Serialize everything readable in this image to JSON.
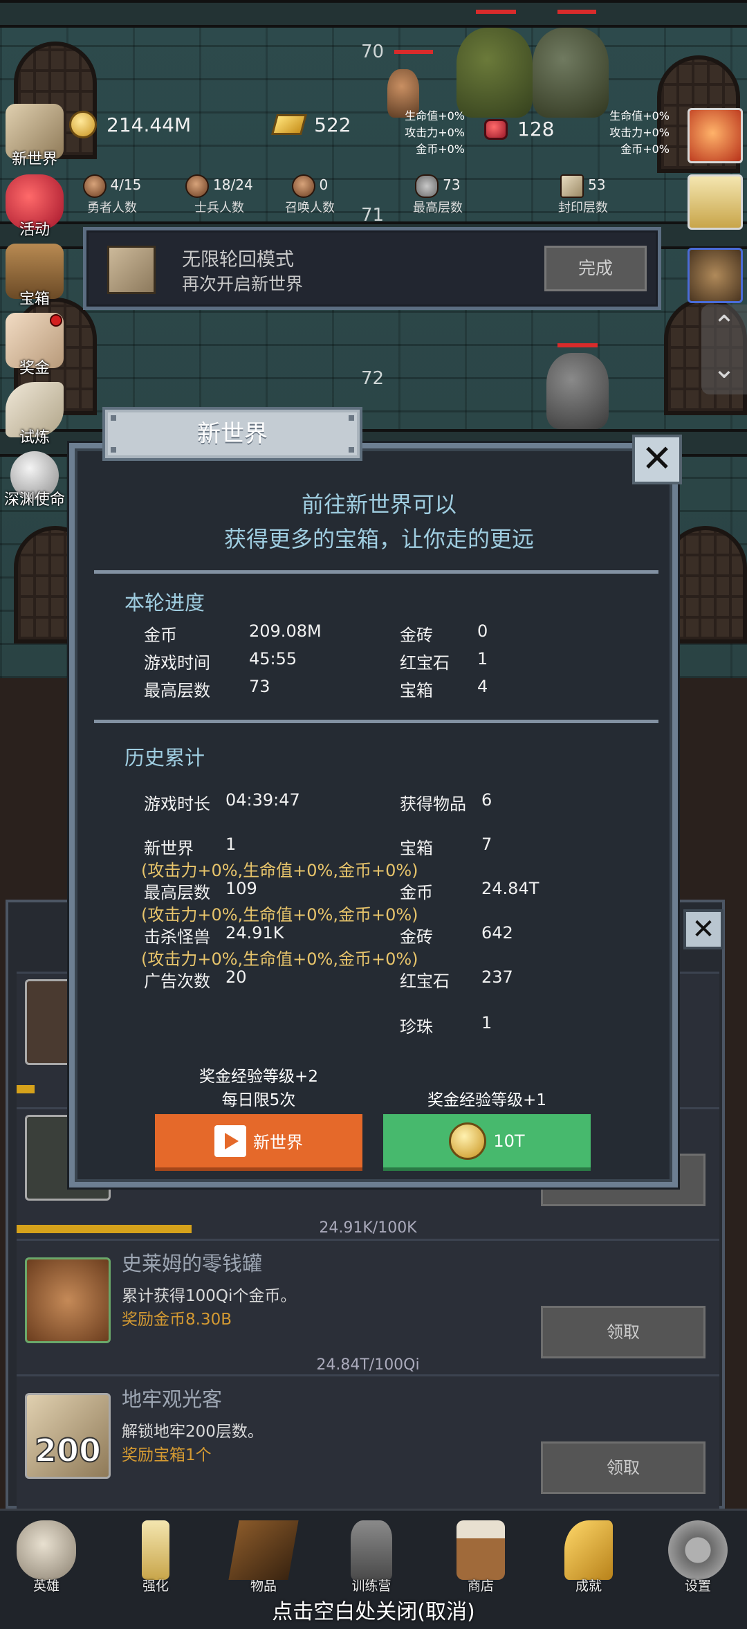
{
  "hud": {
    "gold_coins": "214.44M",
    "gold_bricks": "522",
    "rubies": "128",
    "buffs_left": [
      "生命值+0%",
      "攻击力+0%",
      "金币+0%"
    ],
    "buffs_right": [
      "生命值+0%",
      "攻击力+0%",
      "金币+0%"
    ],
    "heroes": {
      "value": "4/15",
      "label": "勇者人数"
    },
    "soldiers": {
      "value": "18/24",
      "label": "士兵人数"
    },
    "summons": {
      "value": "0",
      "label": "召唤人数"
    },
    "max_floor": {
      "value": "73",
      "label": "最高层数"
    },
    "sealed_floor": {
      "value": "53",
      "label": "封印层数"
    }
  },
  "game": {
    "floors": [
      "70",
      "71",
      "72"
    ]
  },
  "side_menu": [
    "新世界",
    "活动",
    "宝箱",
    "奖金",
    "试炼",
    "深渊使命"
  ],
  "banner": {
    "title": "无限轮回模式",
    "subtitle": "再次开启新世界",
    "button": "完成"
  },
  "modal": {
    "tab": "新世界",
    "headline1": "前往新世界可以",
    "headline2": "获得更多的宝箱，让你走的更远",
    "round": {
      "title": "本轮进度",
      "left": [
        {
          "k": "金币",
          "v": "209.08M"
        },
        {
          "k": "游戏时间",
          "v": "45:55"
        },
        {
          "k": "最高层数",
          "v": "73"
        }
      ],
      "right": [
        {
          "k": "金砖",
          "v": "0"
        },
        {
          "k": "红宝石",
          "v": "1"
        },
        {
          "k": "宝箱",
          "v": "4"
        }
      ]
    },
    "history": {
      "title": "历史累计",
      "play_time": {
        "k": "游戏时长",
        "v": "04:39:47"
      },
      "items": {
        "k": "获得物品",
        "v": "6"
      },
      "new_world": {
        "k": "新世界",
        "v": "1"
      },
      "chests": {
        "k": "宝箱",
        "v": "7"
      },
      "max_floor": {
        "k": "最高层数",
        "v": "109"
      },
      "coins": {
        "k": "金币",
        "v": "24.84T"
      },
      "kills": {
        "k": "击杀怪兽",
        "v": "24.91K"
      },
      "bricks": {
        "k": "金砖",
        "v": "642"
      },
      "ads": {
        "k": "广告次数",
        "v": "20"
      },
      "rubies": {
        "k": "红宝石",
        "v": "237"
      },
      "pearls": {
        "k": "珍珠",
        "v": "1"
      },
      "bonus_note": "(攻击力+0%,生命值+0%,金币+0%)"
    },
    "left_btn_note1": "奖金经验等级+2",
    "left_btn_note2": "每日限5次",
    "right_btn_note": "奖金经验等级+1",
    "left_btn": "新世界",
    "right_btn": "10T"
  },
  "quests": [
    {
      "title": "史莱姆的零钱罐",
      "desc": "累计获得100Qi个金币。",
      "reward": "奖励金币8.30B",
      "button": "领取",
      "progress": "24.84T/100Qi"
    },
    {
      "title": "地牢观光客",
      "desc": "解锁地牢200层数。",
      "reward": "奖励宝箱1个",
      "button": "领取",
      "icon_text": "200"
    }
  ],
  "prev_quest_progress": "24.91K/100K",
  "prev_quest_fill": 0.249,
  "bottom_nav": [
    "英雄",
    "强化",
    "物品",
    "训练营",
    "商店",
    "成就",
    "设置"
  ],
  "close_hint": "点击空白处关闭(取消)"
}
